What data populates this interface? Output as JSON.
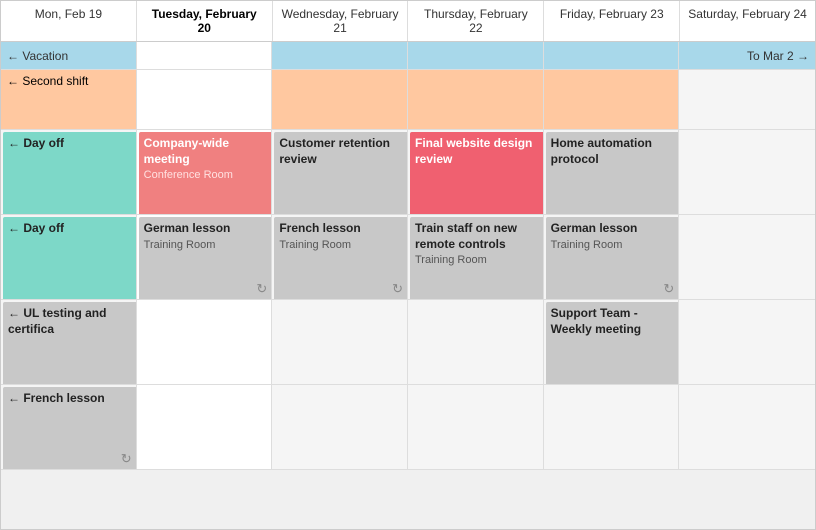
{
  "header": {
    "days": [
      {
        "label": "Mon, Feb 19",
        "today": false
      },
      {
        "label": "Tuesday, February 20",
        "today": true
      },
      {
        "label": "Wednesday, February 21",
        "today": false
      },
      {
        "label": "Thursday, February 22",
        "today": false
      },
      {
        "label": "Friday, February 23",
        "today": false
      },
      {
        "label": "Saturday, February 24",
        "today": false
      }
    ]
  },
  "vacation": {
    "label": "← Vacation",
    "to_label": "To Mar 2 →"
  },
  "second_shift": {
    "label": "← Second shift"
  },
  "rows": [
    {
      "cells": [
        {
          "type": "dayoff",
          "label": "← Day off",
          "color": "teal"
        },
        {
          "type": "event",
          "title": "Company-wide meeting",
          "location": "Conference Room",
          "color": "pink"
        },
        {
          "type": "event",
          "title": "Customer retention review",
          "location": "",
          "color": "gray"
        },
        {
          "type": "event",
          "title": "Final website design review",
          "location": "",
          "color": "salmon"
        },
        {
          "type": "event",
          "title": "Home automation protocol",
          "location": "",
          "color": "gray"
        },
        {
          "type": "empty"
        }
      ]
    },
    {
      "cells": [
        {
          "type": "dayoff",
          "label": "← Day off",
          "color": "teal"
        },
        {
          "type": "event",
          "title": "German lesson",
          "location": "Training Room",
          "color": "gray",
          "recur": true
        },
        {
          "type": "event",
          "title": "French lesson",
          "location": "Training Room",
          "color": "gray",
          "recur": true
        },
        {
          "type": "event",
          "title": "Train staff on new remote controls",
          "location": "Training Room",
          "color": "gray"
        },
        {
          "type": "event",
          "title": "German lesson",
          "location": "Training Room",
          "color": "gray",
          "recur": true
        },
        {
          "type": "empty"
        }
      ]
    },
    {
      "cells": [
        {
          "type": "event",
          "title": "← UL testing and certifica",
          "location": "",
          "color": "gray"
        },
        {
          "type": "empty"
        },
        {
          "type": "empty"
        },
        {
          "type": "empty"
        },
        {
          "type": "event",
          "title": "Support Team - Weekly meeting",
          "location": "",
          "color": "gray"
        },
        {
          "type": "empty"
        }
      ]
    },
    {
      "cells": [
        {
          "type": "event",
          "title": "← French lesson",
          "location": "",
          "color": "gray",
          "recur": true
        },
        {
          "type": "empty"
        },
        {
          "type": "empty"
        },
        {
          "type": "empty"
        },
        {
          "type": "empty"
        },
        {
          "type": "empty"
        }
      ]
    }
  ]
}
